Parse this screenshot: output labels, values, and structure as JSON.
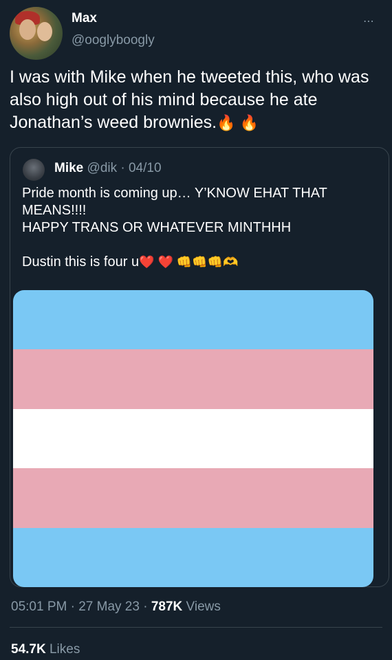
{
  "tweet": {
    "author": {
      "display_name": "Max",
      "handle": "@ooglyboogly"
    },
    "text": "I was with Mike when he tweeted this, who was also high out of his mind because he ate Jonathan’s weed brownies.",
    "text_emoji": "🔥 🔥",
    "timestamp": "05:01 PM · 27 May 23 · ",
    "views_count": "787K",
    "views_label": " Views",
    "likes_count": "54.7K",
    "likes_label": " Likes",
    "more_icon": "⋯"
  },
  "quoted_tweet": {
    "display_name": "Mike",
    "meta": " @dik · 04/10",
    "text": "Pride month is coming up… Y’KNOW EHAT THAT MEANS!!!!\nHAPPY TRANS OR WHATEVER MINTHHH\n\nDustin this is four u",
    "emoji": "❤️ ❤️ 👊👊👊🫶",
    "flag_colors": [
      "#7ac8f4",
      "#e8a9b5",
      "#ffffff",
      "#e8a9b5",
      "#7ac8f4"
    ]
  },
  "colors": {
    "background": "#15202b",
    "text_primary": "#ffffff",
    "text_secondary": "#8899a6",
    "border": "#38444d"
  }
}
